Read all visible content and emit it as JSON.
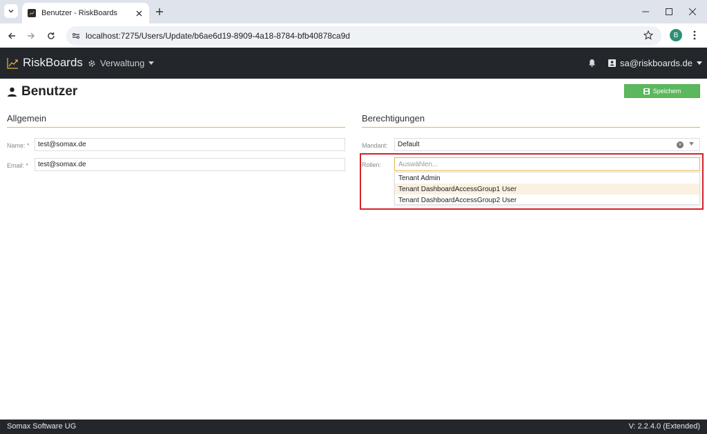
{
  "browser": {
    "tab_title": "Benutzer - RiskBoards",
    "url": "localhost:7275/Users/Update/b6ae6d19-8909-4a18-8784-bfb40878ca9d",
    "profile_initial": "B"
  },
  "app": {
    "brand": "RiskBoards",
    "menu_verwaltung": "Verwaltung",
    "user_email": "sa@riskboards.de"
  },
  "page": {
    "title": "Benutzer",
    "save_label": "Speichern"
  },
  "allgemein": {
    "title": "Allgemein",
    "name_label": "Name: *",
    "name_value": "test@somax.de",
    "email_label": "Email: *",
    "email_value": "test@somax.de"
  },
  "berechtigungen": {
    "title": "Berechtigungen",
    "mandant_label": "Mandant:",
    "mandant_value": "Default",
    "rollen_label": "Rollen:",
    "rollen_placeholder": "Auswählen...",
    "options": [
      "Tenant Admin",
      "Tenant DashboardAccessGroup1 User",
      "Tenant DashboardAccessGroup2 User"
    ]
  },
  "footer": {
    "company": "Somax Software UG",
    "version": "V: 2.2.4.0 (Extended)"
  },
  "colors": {
    "accent": "#e7b34a",
    "save_green": "#5cb85c",
    "header_dark": "#23272b",
    "highlight_red": "#d32029"
  }
}
